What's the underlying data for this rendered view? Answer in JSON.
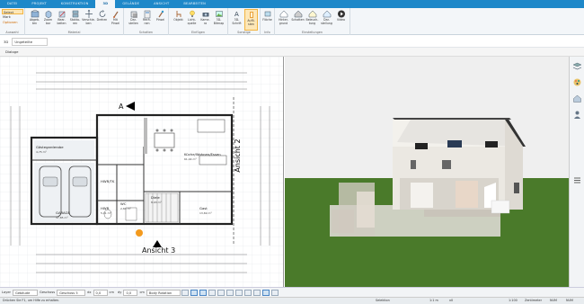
{
  "ribbon_tabs": [
    "DATEI",
    "PROJEKT",
    "KONSTRUKTION",
    "3D",
    "GELÄNDE",
    "ANSICHT",
    "BEARBEITEN"
  ],
  "ribbon_active_tab": "3D",
  "small_buttons": {
    "select": "Select",
    "mark": "Mark",
    "options": "Optionen"
  },
  "ribbon_buttons": [
    {
      "label": "Abgeb-",
      "label2": "ten"
    },
    {
      "label": "Zoom",
      "label2": "bar"
    },
    {
      "label": "Bear-",
      "label2": "beiten"
    },
    {
      "label": "Stakto-",
      "label2": "ren"
    },
    {
      "label": "Verschie-",
      "label2": "ben"
    },
    {
      "label": "Drehen",
      "label2": ""
    },
    {
      "label": "Mit",
      "label2": "Pinsel"
    },
    {
      "label": "Dar-",
      "label2": "stellen"
    },
    {
      "label": "Rech-",
      "label2": "nen"
    },
    {
      "label": "Pinsel",
      "label2": ""
    },
    {
      "label": "Objekt",
      "label2": ""
    },
    {
      "label": "Licht-",
      "label2": "quelle"
    },
    {
      "label": "Kame-",
      "label2": "ra"
    },
    {
      "label": "3D-",
      "label2": "Bitmap"
    },
    {
      "label": "3D-",
      "label2": "Schrift"
    },
    {
      "label": "Aufli-",
      "label2": "sten"
    },
    {
      "label": "Fläche",
      "label2": ""
    },
    {
      "label": "Hinter-",
      "label2": "grund"
    },
    {
      "label": "Schatten",
      "label2": ""
    },
    {
      "label": "Beleuch-",
      "label2": "tung"
    },
    {
      "label": "Dar-",
      "label2": "stellung"
    },
    {
      "label": "Video",
      "label2": ""
    }
  ],
  "ribbon_groups": [
    "Auswahl",
    "Material",
    "Schatten",
    "Einfügen",
    "Sonstige",
    "Info",
    "Einstellungen"
  ],
  "floor_view_label": "3D",
  "floor_select": "Ungeteilte",
  "doc_tab": "Dialoge",
  "plan": {
    "room_labels": [
      {
        "name": "Gästegarderobe",
        "area": "4,75 m²"
      },
      {
        "name": "HWR/TK",
        "area": ""
      },
      {
        "name": "Küche/Wohnen/Essen",
        "area": "61,44 m²"
      },
      {
        "name": "Diele",
        "area": "8,93 m²"
      },
      {
        "name": "GARAGE",
        "area": "37,85 m²"
      },
      {
        "name": "HWR",
        "area": "5,01 m²"
      },
      {
        "name": "WC",
        "area": "2,84 m²"
      },
      {
        "name": "Gast",
        "area": "13,69 m²"
      }
    ],
    "view_labels": {
      "right": "Ansicht 2",
      "bottom": "Ansicht 3",
      "top": "A"
    }
  },
  "bottom_bar": {
    "layer_label": "Layer",
    "layer_value": "Gebäude",
    "floor_label": "Geschoss",
    "floor_value": "Geschoss 5",
    "dx_label": "dx",
    "dx_value": "0,0",
    "dy_label": "dy",
    "dy_value": "0,0",
    "unit": "cm",
    "rotate_label": "Body Rotation",
    "tool_icons": [
      "eye-icon",
      "select-icon",
      "pointer-icon",
      "grid-icon",
      "snap-icon",
      "ortho-icon",
      "layer-icon",
      "lock-icon",
      "hand-icon",
      "measure-icon",
      "zoom-icon"
    ]
  },
  "status_bar": {
    "hint": "Drücken Sie F1, um Hilfe zu erhalten.",
    "selection": "Selektion",
    "scale": "1:1 m",
    "x_value": "x0",
    "ratio": "1:100",
    "zoom": "Zentimeter",
    "caps": "NUM",
    "mode": "NUM"
  },
  "colors": {
    "ribbon_blue": "#1e88c9",
    "sky": "#efefef",
    "grass": "#4a7a2a",
    "active_orange": "#f2b441"
  }
}
